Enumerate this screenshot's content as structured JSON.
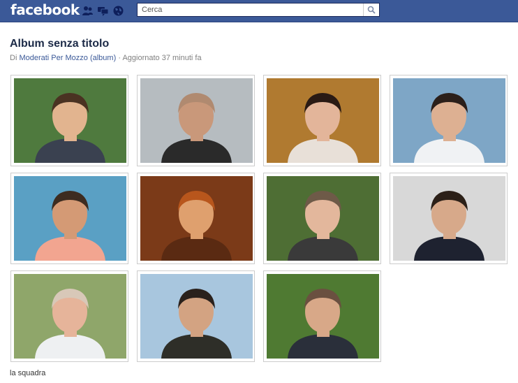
{
  "header": {
    "logo": "facebook",
    "search_placeholder": "Cerca",
    "icons": [
      "friend-requests-icon",
      "messages-icon",
      "notifications-globe-icon",
      "search-icon"
    ]
  },
  "album": {
    "title": "Album senza titolo",
    "by_prefix": "Di",
    "owner": "Moderati Per Mozzo",
    "album_link": "(album)",
    "separator": "·",
    "updated": "Aggiornato 37 minuti fa",
    "caption": "la squadra"
  },
  "photos": [
    {
      "name": "photo-1",
      "bg": "#4f7a3e",
      "skin": "#e2b48f",
      "hair": "#4a3222",
      "clothes": "#3a4150"
    },
    {
      "name": "photo-2",
      "bg": "#b6bcc0",
      "skin": "#c9987a",
      "hair": "#b08a70",
      "clothes": "#2a2a2a"
    },
    {
      "name": "photo-3",
      "bg": "#b07a30",
      "skin": "#e3b59a",
      "hair": "#2a1a14",
      "clothes": "#e8e0d8"
    },
    {
      "name": "photo-4",
      "bg": "#7ea6c6",
      "skin": "#ddb092",
      "hair": "#2b1f1a",
      "clothes": "#f0f2f4"
    },
    {
      "name": "photo-5",
      "bg": "#5aa0c4",
      "skin": "#d49a75",
      "hair": "#3d2c20",
      "clothes": "#f2a590"
    },
    {
      "name": "photo-6",
      "bg": "#7b3a18",
      "skin": "#dfa06e",
      "hair": "#b8561c",
      "clothes": "#5a2a12"
    },
    {
      "name": "photo-7",
      "bg": "#4e6e34",
      "skin": "#e3b79c",
      "hair": "#6e5a48",
      "clothes": "#3a3a3a"
    },
    {
      "name": "photo-8",
      "bg": "#d8d8d8",
      "skin": "#d7a98a",
      "hair": "#2c2018",
      "clothes": "#1e2230"
    },
    {
      "name": "photo-9",
      "bg": "#8fa66a",
      "skin": "#e6b49a",
      "hair": "#d8c8b8",
      "clothes": "#eef0f2"
    },
    {
      "name": "photo-10",
      "bg": "#a8c6de",
      "skin": "#d3a382",
      "hair": "#2a211c",
      "clothes": "#2e2e28"
    },
    {
      "name": "photo-11",
      "bg": "#4f7a32",
      "skin": "#d8a888",
      "hair": "#6a5040",
      "clothes": "#2a2f3a"
    }
  ]
}
